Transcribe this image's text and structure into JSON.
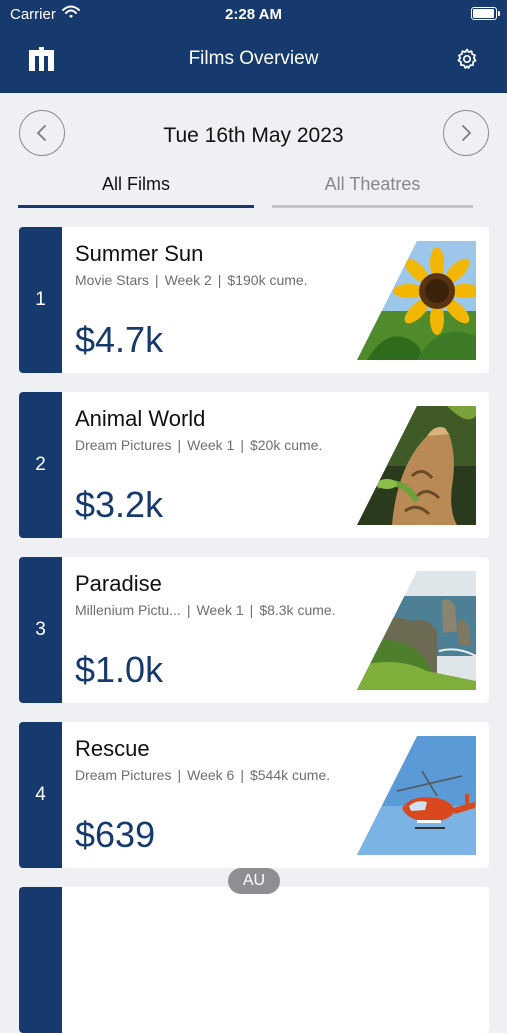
{
  "status_bar": {
    "carrier": "Carrier",
    "time": "2:28 AM"
  },
  "header": {
    "title": "Films Overview"
  },
  "date_nav": {
    "date": "Tue 16th May 2023"
  },
  "tabs": [
    {
      "label": "All Films",
      "selected": true
    },
    {
      "label": "All Theatres",
      "selected": false
    }
  ],
  "films": [
    {
      "rank": "1",
      "title": "Summer Sun",
      "distributor": "Movie Stars",
      "week": "Week 2",
      "cume": "$190k cume.",
      "gross": "$4.7k",
      "image": "sunflower"
    },
    {
      "rank": "2",
      "title": "Animal World",
      "distributor": "Dream Pictures",
      "week": "Week 1",
      "cume": "$20k cume.",
      "gross": "$3.2k",
      "image": "cat"
    },
    {
      "rank": "3",
      "title": "Paradise",
      "distributor": "Millenium Pictu...",
      "week": "Week 1",
      "cume": "$8.3k cume.",
      "gross": "$1.0k",
      "image": "coast"
    },
    {
      "rank": "4",
      "title": "Rescue",
      "distributor": "Dream Pictures",
      "week": "Week 6",
      "cume": "$544k cume.",
      "gross": "$639",
      "image": "helicopter"
    }
  ],
  "region_badge": "AU",
  "colors": {
    "brand": "#173a6e",
    "background": "#eff0f4",
    "card": "#ffffff"
  }
}
